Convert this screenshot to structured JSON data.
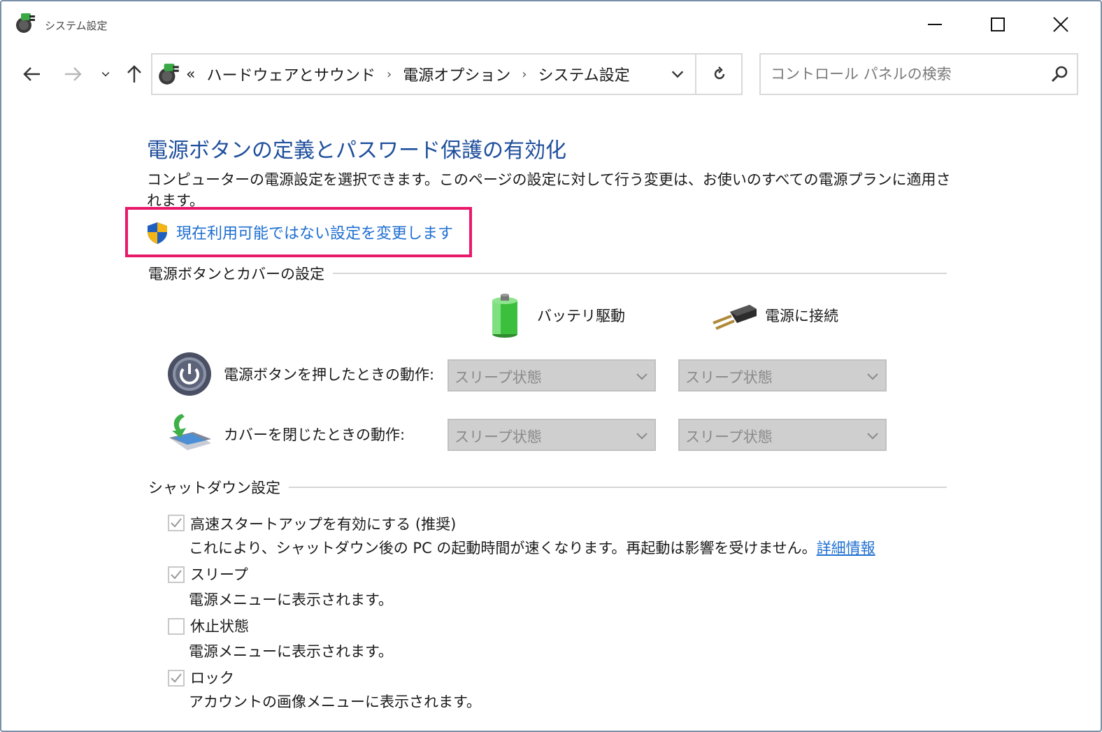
{
  "window": {
    "title": "システム設定",
    "icon": "power-options-icon"
  },
  "nav": {
    "breadcrumb_prefix": "«",
    "breadcrumb": [
      "ハードウェアとサウンド",
      "電源オプション",
      "システム設定"
    ],
    "breadcrumb_separator": "›",
    "search_placeholder": "コントロール パネルの検索"
  },
  "main": {
    "heading": "電源ボタンの定義とパスワード保護の有効化",
    "description": "コンピューターの電源設定を選択できます。このページの設定に対して行う変更は、お使いのすべての電源プランに適用されます。",
    "change_link": "現在利用可能ではない設定を変更します",
    "power_group": {
      "title": "電源ボタンとカバーの設定",
      "battery_label": "バッテリ駆動",
      "plugged_label": "電源に接続",
      "rows": [
        {
          "label": "電源ボタンを押したときの動作:",
          "battery": "スリープ状態",
          "plugged": "スリープ状態"
        },
        {
          "label": "カバーを閉じたときの動作:",
          "battery": "スリープ状態",
          "plugged": "スリープ状態"
        }
      ]
    },
    "shutdown_group": {
      "title": "シャットダウン設定",
      "options": [
        {
          "label": "高速スタートアップを有効にする (推奨)",
          "checked": true,
          "desc": "これにより、シャットダウン後の PC の起動時間が速くなります。再起動は影響を受けません。",
          "link": "詳細情報"
        },
        {
          "label": "スリープ",
          "checked": true,
          "desc": "電源メニューに表示されます。"
        },
        {
          "label": "休止状態",
          "checked": false,
          "desc": "電源メニューに表示されます。"
        },
        {
          "label": "ロック",
          "checked": true,
          "desc": "アカウントの画像メニューに表示されます。"
        }
      ]
    }
  },
  "colors": {
    "heading": "#1e4f9c",
    "link": "#1f6fd1",
    "highlight": "#e8196b",
    "disabled_select": "#cfcfcf"
  }
}
